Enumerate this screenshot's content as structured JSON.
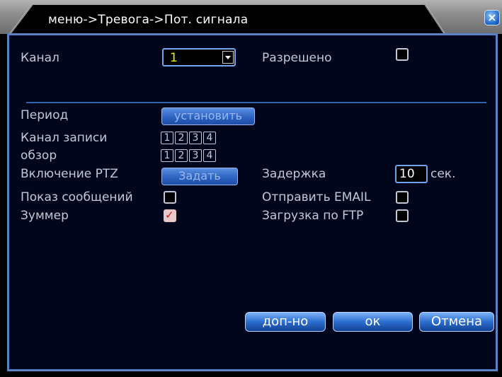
{
  "window": {
    "title": "меню->Тревога->Пот. сигнала",
    "close_label": "×"
  },
  "form": {
    "channel_label": "Канал",
    "channel_value": "1",
    "enabled_label": "Разрешено",
    "period_label": "Период",
    "period_button": "установить",
    "record_channel_label": "Канал записи",
    "record_channels": [
      "1",
      "2",
      "3",
      "4"
    ],
    "tour_label": "обзор",
    "tour_channels": [
      "1",
      "2",
      "3",
      "4"
    ],
    "ptz_label": "Включение PTZ",
    "ptz_button": "Задать",
    "delay_label": "Задержка",
    "delay_value": "10",
    "delay_unit": "сек.",
    "show_message_label": "Показ сообщений",
    "send_email_label": "Отправить EMAIL",
    "buzzer_label": "Зуммер",
    "ftp_label": "Загрузка по FTP"
  },
  "states": {
    "enabled_checked": false,
    "show_message_checked": false,
    "send_email_checked": false,
    "buzzer_checked": true,
    "ftp_checked": false
  },
  "buttons": {
    "advanced": "доп-но",
    "ok": "ок",
    "cancel": "Отмена"
  }
}
